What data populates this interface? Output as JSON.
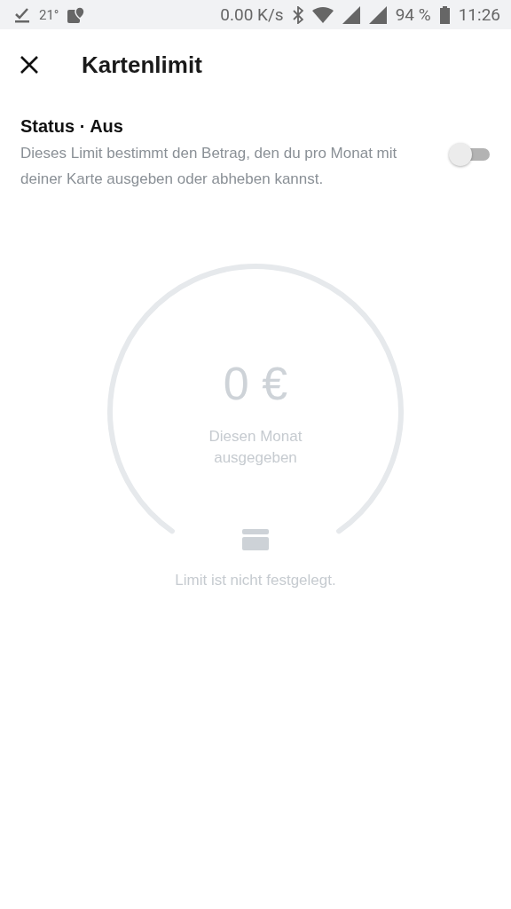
{
  "status_bar": {
    "temperature": "21°",
    "speed": "0.00 K/s",
    "battery": "94 %",
    "time": "11:26"
  },
  "header": {
    "title": "Kartenlimit"
  },
  "status": {
    "title": "Status · Aus",
    "description": "Dieses Limit bestimmt den Betrag, den du pro Monat mit deiner Karte ausgeben oder abheben kannst.",
    "on": false
  },
  "gauge": {
    "amount": "0 €",
    "caption": "Diesen Monat ausgegeben",
    "note": "Limit ist nicht festgelegt."
  }
}
